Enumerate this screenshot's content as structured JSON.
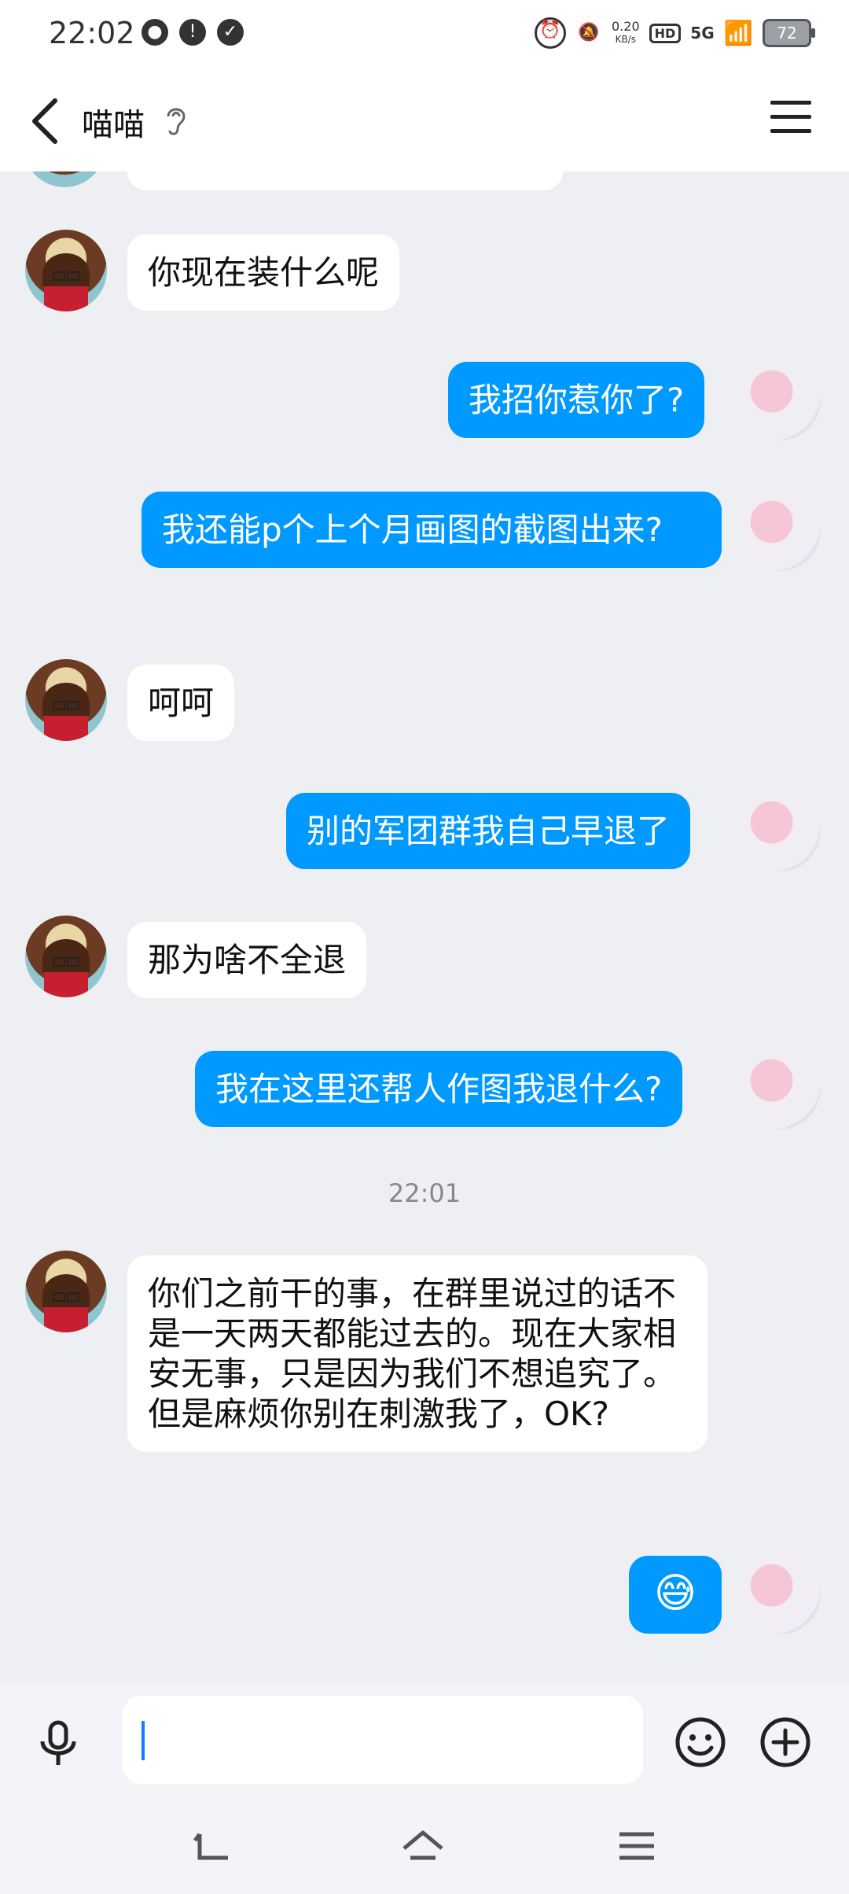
{
  "status_bar": {
    "time": "22:02",
    "net_speed_value": "0.20",
    "net_speed_unit": "KB/s",
    "hd": "HD",
    "signal": "5G",
    "battery": "72"
  },
  "header": {
    "title": "喵喵"
  },
  "messages": [
    {
      "side": "left",
      "text": "你现在装什么呢"
    },
    {
      "side": "right",
      "text": "我招你惹你了?"
    },
    {
      "side": "right",
      "text": "我还能p个上个月画图的截图出来?"
    },
    {
      "side": "left",
      "text": "呵呵"
    },
    {
      "side": "right",
      "text": "别的军团群我自己早退了"
    },
    {
      "side": "left",
      "text": "那为啥不全退"
    },
    {
      "side": "right",
      "text": "我在这里还帮人作图我退什么?"
    },
    {
      "timestamp": "22:01"
    },
    {
      "side": "left",
      "text": "你们之前干的事，在群里说过的话不是一天两天都能过去的。现在大家相安无事，只是因为我们不想追究了。但是麻烦你别在刺激我了，OK?"
    },
    {
      "side": "right",
      "text": "😅"
    }
  ],
  "colors": {
    "outgoing_bubble": "#0099ff",
    "incoming_bubble": "#ffffff",
    "chat_background": "#eeeff3"
  },
  "icons": {
    "back": "chevron-left-icon",
    "ear": "ear-icon",
    "menu": "hamburger-menu-icon",
    "mic": "microphone-icon",
    "emoji": "smiley-face-icon",
    "plus": "plus-circle-icon"
  }
}
